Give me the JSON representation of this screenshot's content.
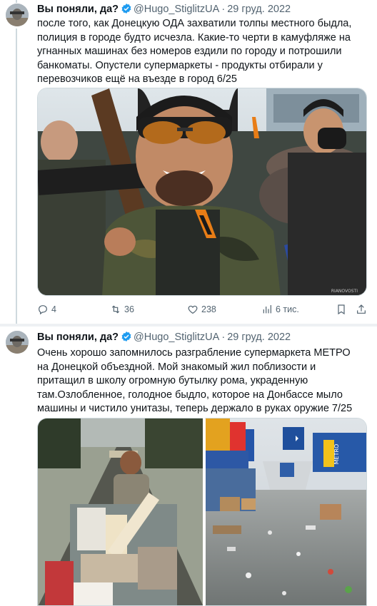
{
  "tweets": [
    {
      "author_name": "Вы поняли, да?",
      "handle": "@Hugo_StiglitzUA",
      "separator": "·",
      "date": "29 груд. 2022",
      "text": "после того, как Донецкую ОДА захватили толпы местного быдла, полиция в городе будто исчезла. Какие-то черти в камуфляже на угнанных машинах без номеров ездили по городу и потрошили банкоматы. Опустели супермаркеты - продукты отбирали у перевозчиков ещё на въезде в город 6/25",
      "media_watermark": "RIANOVOSTI",
      "actions": {
        "replies": "4",
        "retweets": "36",
        "likes": "238",
        "views": "6 тис."
      }
    },
    {
      "author_name": "Вы поняли, да?",
      "handle": "@Hugo_StiglitzUA",
      "separator": "·",
      "date": "29 груд. 2022",
      "text": "Очень хорошо запомнилось разграбление супермаркета МЕТРО на Донецкой объездной. Мой знакомый жил поблизости и притащил в школу огромную бутылку рома, украденную там.Озлобленное, голодное быдло, которое на Донбассе мыло машины и чистило унитазы, теперь держало в руках оружие 7/25",
      "store_sign": "METRO"
    }
  ],
  "icons": {
    "verified": "verified-badge-icon",
    "reply": "reply-icon",
    "retweet": "retweet-icon",
    "like": "heart-icon",
    "views": "views-chart-icon",
    "bookmark": "bookmark-icon",
    "share": "share-icon"
  },
  "colors": {
    "verified_blue": "#1d9bf0",
    "text_secondary": "#536471",
    "thread_line": "#cfd9de"
  }
}
